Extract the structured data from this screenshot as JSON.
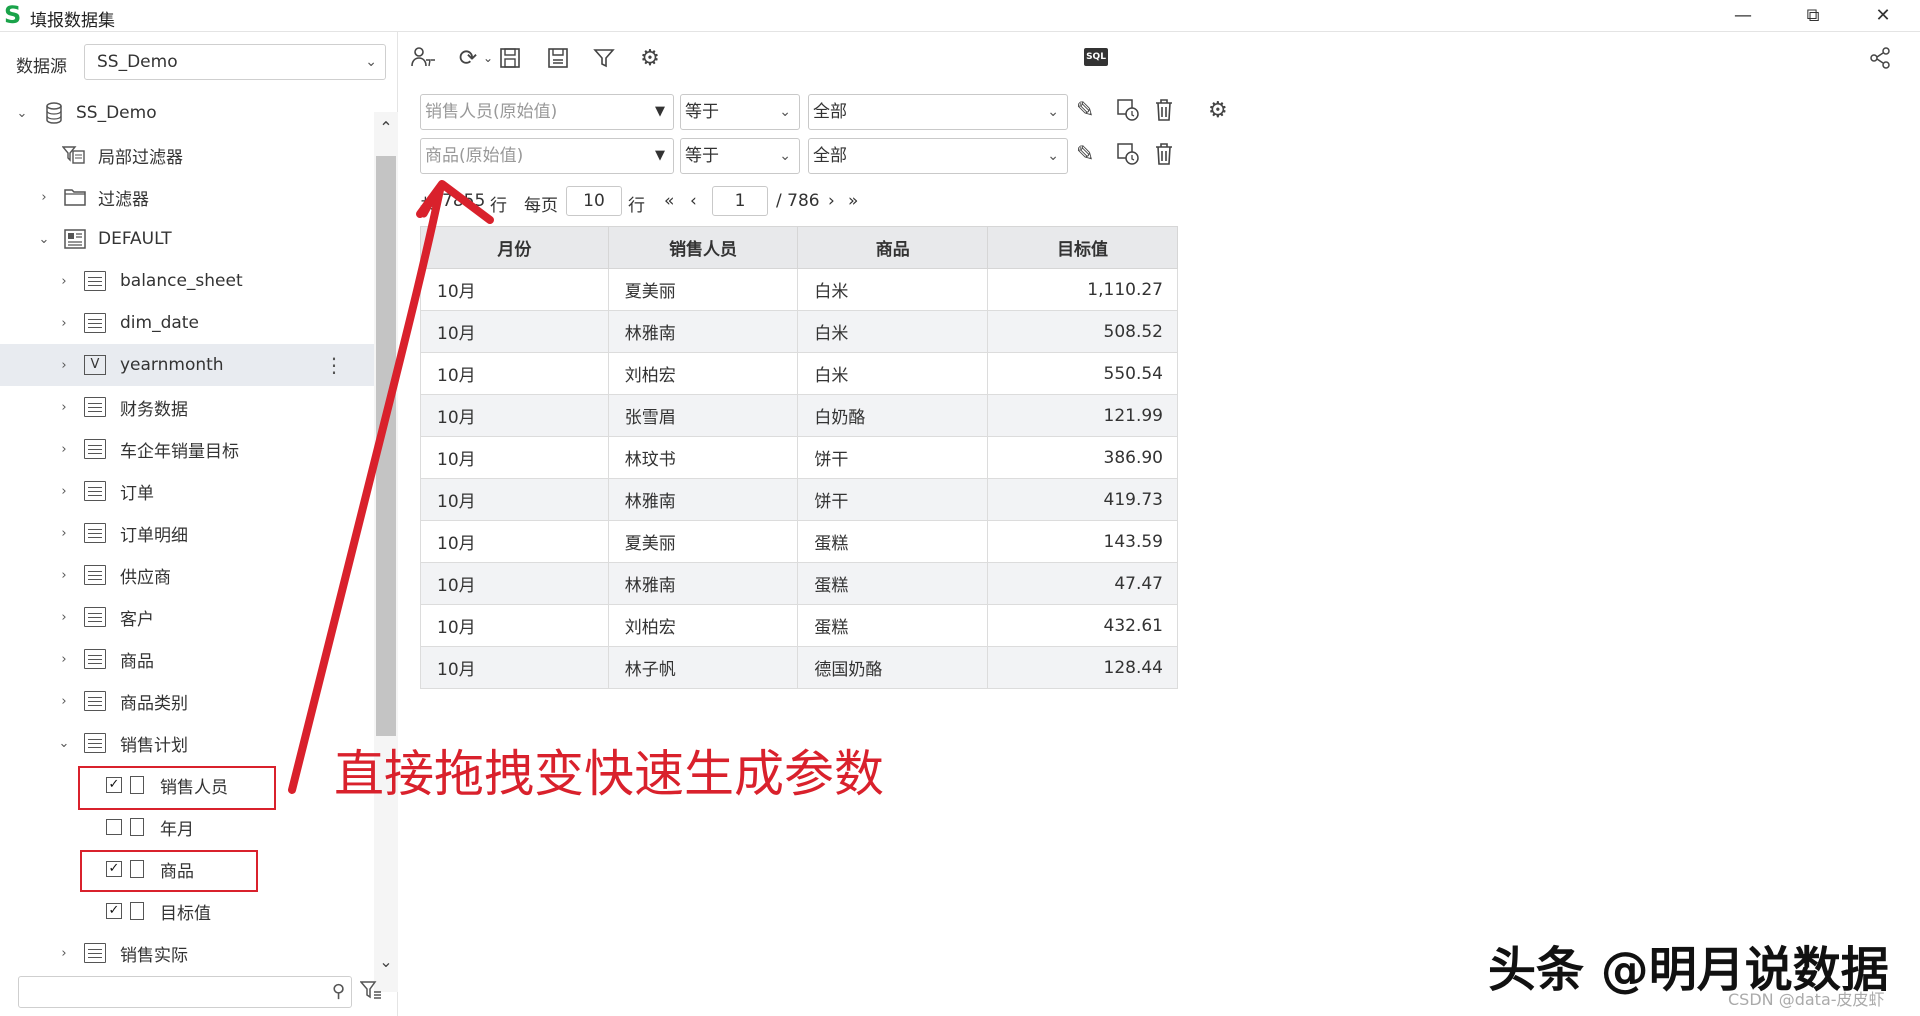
{
  "window": {
    "title": "填报数据集",
    "logo": "S",
    "controls": [
      "minimize-icon",
      "restore-icon",
      "close-icon"
    ]
  },
  "left_panel": {
    "datasource_label": "数据源",
    "datasource_value": "SS_Demo",
    "tree": [
      {
        "label": "SS_Demo",
        "type": "database",
        "expanded": true
      },
      {
        "label": "局部过滤器",
        "type": "local-filter"
      },
      {
        "label": "过滤器",
        "type": "folder",
        "expanded": false
      },
      {
        "label": "DEFAULT",
        "type": "schema",
        "expanded": true
      },
      {
        "label": "balance_sheet",
        "type": "table"
      },
      {
        "label": "dim_date",
        "type": "table"
      },
      {
        "label": "yearnmonth",
        "type": "view",
        "selected": true
      },
      {
        "label": "财务数据",
        "type": "table"
      },
      {
        "label": "车企年销量目标",
        "type": "table"
      },
      {
        "label": "订单",
        "type": "table"
      },
      {
        "label": "订单明细",
        "type": "table"
      },
      {
        "label": "供应商",
        "type": "table"
      },
      {
        "label": "客户",
        "type": "table"
      },
      {
        "label": "商品",
        "type": "table"
      },
      {
        "label": "商品类别",
        "type": "table"
      },
      {
        "label": "销售计划",
        "type": "table",
        "expanded": true
      },
      {
        "label": "销售人员",
        "type": "field",
        "checked": true
      },
      {
        "label": "年月",
        "type": "field",
        "checked": false
      },
      {
        "label": "商品",
        "type": "field",
        "checked": true
      },
      {
        "label": "目标值",
        "type": "field",
        "checked": true
      },
      {
        "label": "销售实际",
        "type": "table"
      }
    ],
    "search_placeholder": ""
  },
  "filters": [
    {
      "field": "销售人员(原始值)",
      "operator": "等于",
      "value": "全部"
    },
    {
      "field": "商品(原始值)",
      "operator": "等于",
      "value": "全部"
    }
  ],
  "pager": {
    "total_prefix": "共",
    "total_rows": "7855",
    "rows_unit": "行",
    "per_page_label": "每页",
    "per_page": "10",
    "current_page": "1",
    "total_pages": "/ 786"
  },
  "table": {
    "columns": [
      "月份",
      "销售人员",
      "商品",
      "目标值"
    ],
    "rows": [
      [
        "10月",
        "夏美丽",
        "白米",
        "1,110.27"
      ],
      [
        "10月",
        "林雅南",
        "白米",
        "508.52"
      ],
      [
        "10月",
        "刘柏宏",
        "白米",
        "550.54"
      ],
      [
        "10月",
        "张雪眉",
        "白奶酪",
        "121.99"
      ],
      [
        "10月",
        "林玟书",
        "饼干",
        "386.90"
      ],
      [
        "10月",
        "林雅南",
        "饼干",
        "419.73"
      ],
      [
        "10月",
        "夏美丽",
        "蛋糕",
        "143.59"
      ],
      [
        "10月",
        "林雅南",
        "蛋糕",
        "47.47"
      ],
      [
        "10月",
        "刘柏宏",
        "蛋糕",
        "432.61"
      ],
      [
        "10月",
        "林子帆",
        "德国奶酪",
        "128.44"
      ]
    ]
  },
  "annotation": "直接拖拽变快速生成参数",
  "watermark": "头条 @明月说数据",
  "csdn": "CSDN @data-皮皮虾",
  "colors": {
    "annotation": "#d9212c",
    "logo": "#1aa34a",
    "selected_row": "#e8ebf0",
    "header_bg": "#e8e9eb"
  }
}
